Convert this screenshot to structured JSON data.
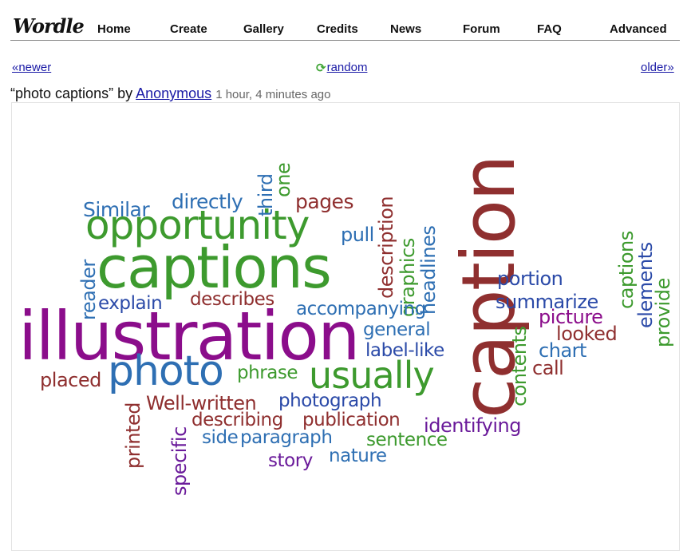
{
  "nav": {
    "logo": "Wordle",
    "items": [
      "Home",
      "Create",
      "Gallery",
      "Credits",
      "News",
      "Forum",
      "FAQ",
      "Advanced"
    ]
  },
  "subnav": {
    "newer": "«newer",
    "random_icon": "refresh-icon",
    "random": "random",
    "older": "older»"
  },
  "wordle": {
    "title": "“photo captions”",
    "by": "by",
    "author": "Anonymous",
    "time": "1 hour, 4 minutes ago"
  },
  "colors": {
    "green": "#3d9a2e",
    "blue": "#2e6fb3",
    "darkblue": "#2b4aa8",
    "red": "#8f2f2f",
    "purple": "#8b0d8b",
    "violet": "#6a1a9a",
    "link": "#1a1aa6"
  },
  "cloud": {
    "words": [
      {
        "text": "illustration",
        "color": "purple"
      },
      {
        "text": "caption",
        "color": "red"
      },
      {
        "text": "captions",
        "color": "green"
      },
      {
        "text": "opportunity",
        "color": "green"
      },
      {
        "text": "photo",
        "color": "blue"
      },
      {
        "text": "usually",
        "color": "green"
      },
      {
        "text": "Similar",
        "color": "blue"
      },
      {
        "text": "directly",
        "color": "blue"
      },
      {
        "text": "third",
        "color": "blue"
      },
      {
        "text": "one",
        "color": "green"
      },
      {
        "text": "pages",
        "color": "red"
      },
      {
        "text": "pull",
        "color": "blue"
      },
      {
        "text": "description",
        "color": "red"
      },
      {
        "text": "graphics",
        "color": "green"
      },
      {
        "text": "headlines",
        "color": "blue"
      },
      {
        "text": "reader",
        "color": "blue"
      },
      {
        "text": "explain",
        "color": "darkblue"
      },
      {
        "text": "describes",
        "color": "red"
      },
      {
        "text": "accompanying",
        "color": "blue"
      },
      {
        "text": "general",
        "color": "blue"
      },
      {
        "text": "label-like",
        "color": "darkblue"
      },
      {
        "text": "portion",
        "color": "darkblue"
      },
      {
        "text": "summarize",
        "color": "darkblue"
      },
      {
        "text": "picture",
        "color": "purple"
      },
      {
        "text": "looked",
        "color": "red"
      },
      {
        "text": "chart",
        "color": "blue"
      },
      {
        "text": "call",
        "color": "red"
      },
      {
        "text": "contents",
        "color": "green"
      },
      {
        "text": "captions",
        "color": "green"
      },
      {
        "text": "elements",
        "color": "darkblue"
      },
      {
        "text": "provide",
        "color": "green"
      },
      {
        "text": "placed",
        "color": "red"
      },
      {
        "text": "phrase",
        "color": "green"
      },
      {
        "text": "printed",
        "color": "red"
      },
      {
        "text": "Well-written",
        "color": "red"
      },
      {
        "text": "photograph",
        "color": "darkblue"
      },
      {
        "text": "specific",
        "color": "violet"
      },
      {
        "text": "describing",
        "color": "red"
      },
      {
        "text": "publication",
        "color": "red"
      },
      {
        "text": "identifying",
        "color": "violet"
      },
      {
        "text": "side",
        "color": "blue"
      },
      {
        "text": "paragraph",
        "color": "blue"
      },
      {
        "text": "sentence",
        "color": "green"
      },
      {
        "text": "story",
        "color": "violet"
      },
      {
        "text": "nature",
        "color": "blue"
      }
    ]
  }
}
